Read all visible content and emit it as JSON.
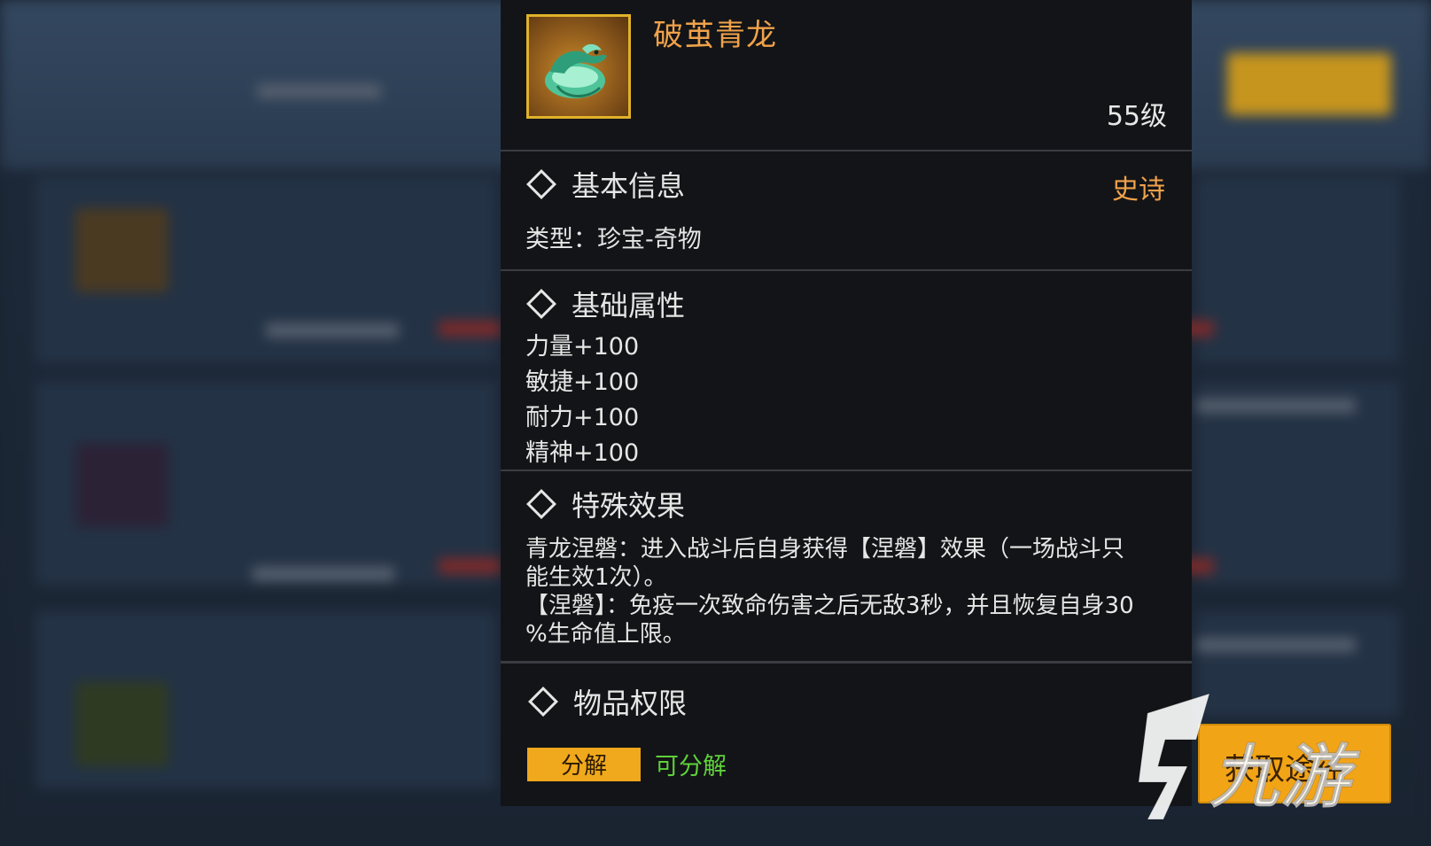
{
  "item": {
    "name": "破茧青龙",
    "level": "55级",
    "icon": "green-dragon-icon"
  },
  "basic_info": {
    "title": "基本信息",
    "rarity": "史诗",
    "type_line": "类型：珍宝-奇物"
  },
  "base_attributes": {
    "title": "基础属性",
    "lines": [
      "力量+100",
      "敏捷+100",
      "耐力+100",
      "精神+100"
    ]
  },
  "special_effect": {
    "title": "特殊效果",
    "lines": [
      "青龙涅磐：进入战斗后自身获得【涅磐】效果（一场战斗只",
      "能生效1次）。",
      "【涅磐】：免疫一次致命伤害之后无敌3秒，并且恢复自身30",
      "%生命值上限。"
    ]
  },
  "permissions": {
    "title": "物品权限",
    "button": "分解",
    "status": "可分解"
  },
  "obtain_button": "获取途径",
  "watermark": "九游",
  "colors": {
    "item_name": "#f0a24a",
    "rarity": "#f0a24a",
    "perm_button": "#f0a81c",
    "perm_status": "#5ed13a",
    "card_bg": "#131417"
  }
}
